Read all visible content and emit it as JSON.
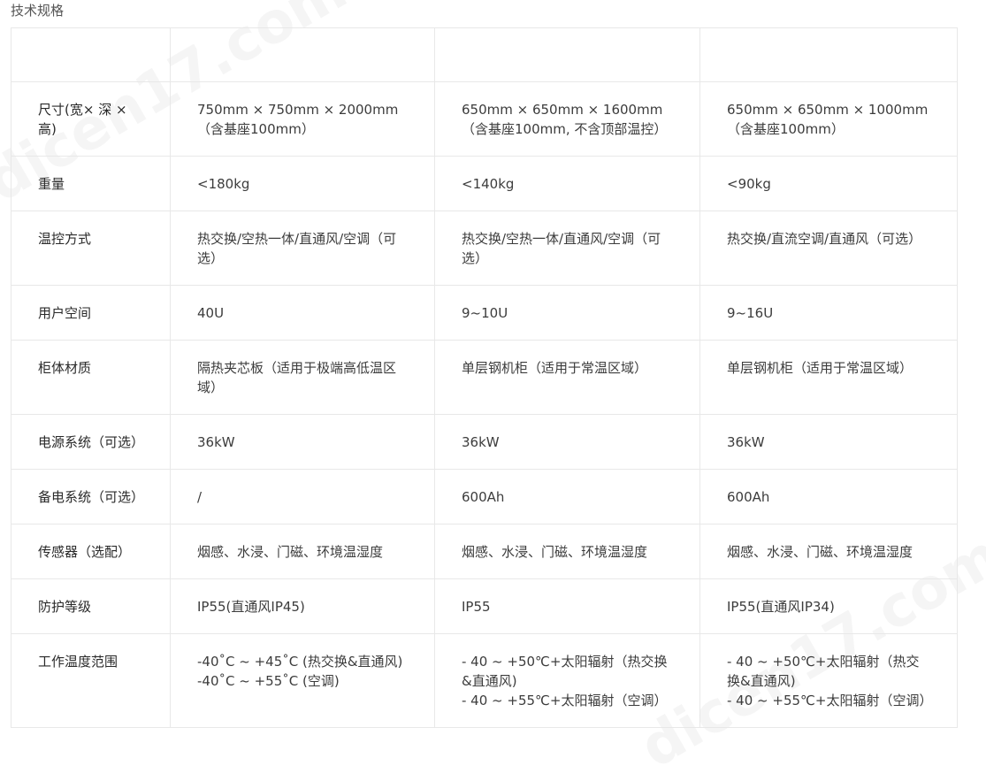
{
  "page_title": "技术规格",
  "watermark_text": "dicen17.com",
  "table": {
    "header": [
      "",
      "",
      "",
      ""
    ],
    "rows": [
      {
        "label": "尺寸(宽× 深 ×高)",
        "values": [
          [
            "750mm × 750mm × 2000mm（含基座100mm）"
          ],
          [
            "650mm × 650mm × 1600mm（含基座100mm, 不含顶部温控）"
          ],
          [
            "650mm × 650mm × 1000mm（含基座100mm）"
          ]
        ]
      },
      {
        "label": "重量",
        "values": [
          [
            "<180kg"
          ],
          [
            "<140kg"
          ],
          [
            "<90kg"
          ]
        ]
      },
      {
        "label": "温控方式",
        "values": [
          [
            "热交换/空热一体/直通风/空调（可选）"
          ],
          [
            "热交换/空热一体/直通风/空调（可选）"
          ],
          [
            "热交换/直流空调/直通风（可选）"
          ]
        ]
      },
      {
        "label": "用户空间",
        "values": [
          [
            "40U"
          ],
          [
            "9~10U"
          ],
          [
            "9~16U"
          ]
        ]
      },
      {
        "label": "柜体材质",
        "values": [
          [
            "隔热夹芯板（适用于极端高低温区域）"
          ],
          [
            "单层钢机柜（适用于常温区域）"
          ],
          [
            "单层钢机柜（适用于常温区域）"
          ]
        ]
      },
      {
        "label": "电源系统（可选）",
        "values": [
          [
            "36kW"
          ],
          [
            "36kW"
          ],
          [
            "36kW"
          ]
        ]
      },
      {
        "label": "备电系统（可选）",
        "values": [
          [
            "/"
          ],
          [
            "600Ah"
          ],
          [
            "600Ah"
          ]
        ]
      },
      {
        "label": "传感器（选配）",
        "values": [
          [
            "烟感、水浸、门磁、环境温湿度"
          ],
          [
            "烟感、水浸、门磁、环境温湿度"
          ],
          [
            "烟感、水浸、门磁、环境温湿度"
          ]
        ]
      },
      {
        "label": "防护等级",
        "values": [
          [
            "IP55(直通风IP45)"
          ],
          [
            "IP55"
          ],
          [
            "IP55(直通风IP34)"
          ]
        ]
      },
      {
        "label": "工作温度范围",
        "values": [
          [
            "-40˚C ~ +45˚C (热交换&直通风)",
            "-40˚C ~ +55˚C (空调)"
          ],
          [
            " - 40 ~ +50℃+太阳辐射（热交换&直通风)",
            " - 40 ~ +55℃+太阳辐射（空调）"
          ],
          [
            " - 40 ~ +50℃+太阳辐射（热交换&直通风)",
            " - 40 ~ +55℃+太阳辐射（空调）"
          ]
        ]
      }
    ]
  }
}
